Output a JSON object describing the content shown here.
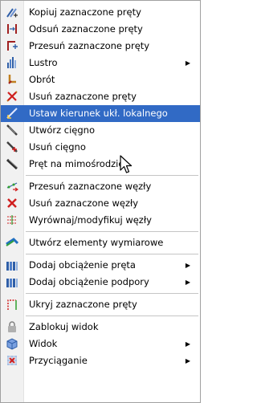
{
  "menu": {
    "items": [
      {
        "label": "Kopiuj zaznaczone pręty",
        "icon": "copy-bars-icon"
      },
      {
        "label": "Odsuń zaznaczone pręty",
        "icon": "offset-bars-icon"
      },
      {
        "label": "Przesuń zaznaczone pręty",
        "icon": "move-bars-icon"
      },
      {
        "label": "Lustro",
        "icon": "mirror-icon",
        "submenu": true
      },
      {
        "label": "Obrót",
        "icon": "rotate-icon"
      },
      {
        "label": "Usuń zaznaczone pręty",
        "icon": "delete-bars-icon"
      },
      {
        "label": "Ustaw kierunek ukł. lokalnego",
        "icon": "local-axis-icon",
        "highlighted": true
      },
      {
        "label": "Utwórz cięgno",
        "icon": "create-cable-icon"
      },
      {
        "label": "Usuń cięgno",
        "icon": "delete-cable-icon"
      },
      {
        "label": "Pręt na mimośrodzie",
        "icon": "eccentric-bar-icon"
      },
      {
        "label": "Przesuń zaznaczone węzły",
        "icon": "move-nodes-icon"
      },
      {
        "label": "Usuń zaznaczone węzły",
        "icon": "delete-nodes-icon"
      },
      {
        "label": "Wyrównaj/modyfikuj węzły",
        "icon": "align-nodes-icon"
      },
      {
        "label": "Utwórz elementy wymiarowe",
        "icon": "dimension-elements-icon"
      },
      {
        "label": "Dodaj obciążenie pręta",
        "icon": "bar-load-icon",
        "submenu": true
      },
      {
        "label": "Dodaj obciążenie podpory",
        "icon": "support-load-icon",
        "submenu": true
      },
      {
        "label": "Ukryj zaznaczone pręty",
        "icon": "hide-bars-icon"
      },
      {
        "label": "Zablokuj widok",
        "icon": "lock-view-icon"
      },
      {
        "label": "Widok",
        "icon": "view-icon",
        "submenu": true
      },
      {
        "label": "Przyciąganie",
        "icon": "snap-icon",
        "submenu": true
      }
    ],
    "highlight_color": "#316ac5",
    "submenu_arrow": "▶"
  }
}
